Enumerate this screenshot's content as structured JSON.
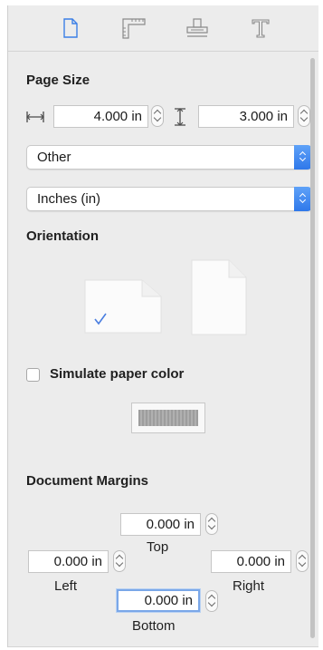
{
  "tabs": [
    {
      "name": "document"
    },
    {
      "name": "grid"
    },
    {
      "name": "alignment"
    },
    {
      "name": "typography"
    }
  ],
  "page_size": {
    "title": "Page Size",
    "width_value": "4.000 in",
    "height_value": "3.000 in",
    "size_preset": "Other",
    "units": "Inches (in)"
  },
  "orientation": {
    "title": "Orientation",
    "selected": "landscape"
  },
  "paper_color": {
    "label": "Simulate paper color",
    "checked": false
  },
  "margins": {
    "title": "Document Margins",
    "top_value": "0.000 in",
    "top_label": "Top",
    "left_value": "0.000 in",
    "left_label": "Left",
    "right_value": "0.000 in",
    "right_label": "Right",
    "bottom_value": "0.000 in",
    "bottom_label": "Bottom"
  },
  "colors": {
    "accent": "#2f78ea",
    "focus_ring": "#7aa7e8",
    "checkmark": "#4a7ee0"
  }
}
